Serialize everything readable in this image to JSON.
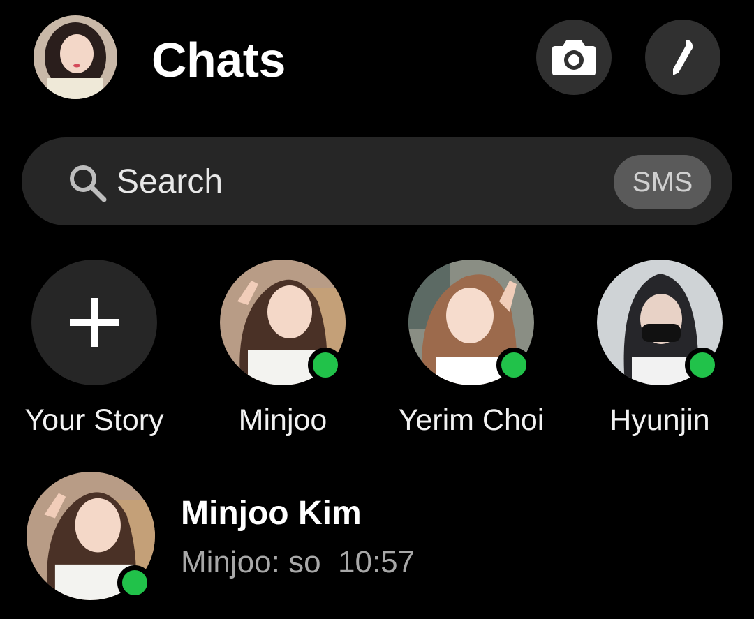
{
  "header": {
    "title": "Chats",
    "profile_avatar": "user-photo",
    "camera_icon": "camera-icon",
    "compose_icon": "pencil-icon"
  },
  "search": {
    "placeholder": "Search",
    "badge": "SMS",
    "icon": "search-icon"
  },
  "stories": [
    {
      "label": "Your Story",
      "type": "add",
      "icon": "plus-icon"
    },
    {
      "label": "Minjoo",
      "online": true
    },
    {
      "label": "Yerim Choi",
      "online": true
    },
    {
      "label": "Hyunjin",
      "online": true
    }
  ],
  "chats": [
    {
      "name": "Minjoo Kim",
      "preview": "Minjoo: so",
      "time": "10:57",
      "online": true
    }
  ],
  "colors": {
    "background": "#000000",
    "surface": "#262626",
    "button": "#303030",
    "online": "#21c24a",
    "secondary_text": "#a8a8a8"
  }
}
